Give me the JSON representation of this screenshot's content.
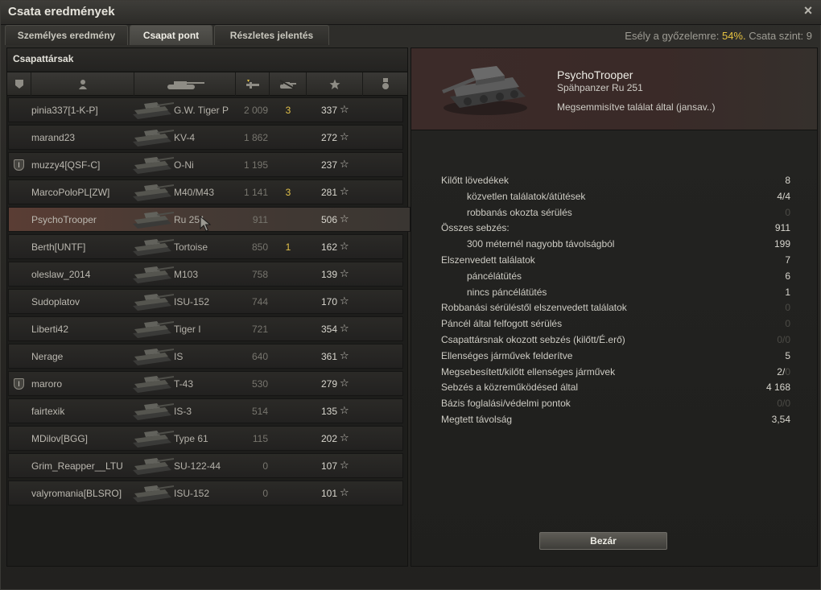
{
  "window": {
    "title": "Csata eredmények"
  },
  "tabs": [
    {
      "label": "Személyes eredmény"
    },
    {
      "label": "Csapat pont"
    },
    {
      "label": "Részletes jelentés"
    }
  ],
  "odds": {
    "prefix": "Esély a győzelemre:",
    "percent": "54%.",
    "tier_text": "Csata szint: 9"
  },
  "left_panel": {
    "title": "Csapattársak"
  },
  "columns": [
    "squad-icon",
    "player-icon",
    "tank-icon",
    "damage-icon",
    "kills-icon",
    "xp-star-icon",
    "medal-icon"
  ],
  "players": [
    {
      "name": "pinia337[1-K-P]",
      "tank": "G.W. Tiger P",
      "damage": "2 009",
      "kills": "3",
      "xp": "337",
      "platoon": ""
    },
    {
      "name": "marand23",
      "tank": "KV-4",
      "damage": "1 862",
      "kills": "",
      "xp": "272",
      "platoon": ""
    },
    {
      "name": "muzzy4[QSF-C]",
      "tank": "O-Ni",
      "damage": "1 195",
      "kills": "",
      "xp": "237",
      "platoon": "I"
    },
    {
      "name": "MarcoPoloPL[ZW]",
      "tank": "M40/M43",
      "damage": "1 141",
      "kills": "3",
      "xp": "281",
      "platoon": ""
    },
    {
      "name": "PsychoTrooper",
      "tank": "Ru 251",
      "damage": "911",
      "kills": "",
      "xp": "506",
      "platoon": ""
    },
    {
      "name": "Berth[UNTF]",
      "tank": "Tortoise",
      "damage": "850",
      "kills": "1",
      "xp": "162",
      "platoon": ""
    },
    {
      "name": "oleslaw_2014",
      "tank": "M103",
      "damage": "758",
      "kills": "",
      "xp": "139",
      "platoon": ""
    },
    {
      "name": "Sudoplatov",
      "tank": "ISU-152",
      "damage": "744",
      "kills": "",
      "xp": "170",
      "platoon": ""
    },
    {
      "name": "Liberti42",
      "tank": "Tiger I",
      "damage": "721",
      "kills": "",
      "xp": "354",
      "platoon": ""
    },
    {
      "name": "Nerage",
      "tank": "IS",
      "damage": "640",
      "kills": "",
      "xp": "361",
      "platoon": ""
    },
    {
      "name": "maroro",
      "tank": "T-43",
      "damage": "530",
      "kills": "",
      "xp": "279",
      "platoon": "I"
    },
    {
      "name": "fairtexik",
      "tank": "IS-3",
      "damage": "514",
      "kills": "",
      "xp": "135",
      "platoon": ""
    },
    {
      "name": "MDilov[BGG]",
      "tank": "Type 61",
      "damage": "115",
      "kills": "",
      "xp": "202",
      "platoon": ""
    },
    {
      "name": "Grim_Reapper__LTU",
      "tank": "SU-122-44",
      "damage": "0",
      "kills": "",
      "xp": "107",
      "platoon": ""
    },
    {
      "name": "valyromania[BLSRO]",
      "tank": "ISU-152",
      "damage": "0",
      "kills": "",
      "xp": "101",
      "platoon": ""
    }
  ],
  "selected": {
    "player": "PsychoTrooper",
    "vehicle": "Spähpanzer Ru 251",
    "status": "Megsemmisítve találat által (jansav..)"
  },
  "stats": [
    {
      "label": "Kilőtt lövedékek",
      "value": "8",
      "sub": false,
      "dim": false
    },
    {
      "label": "közvetlen találatok/átütések",
      "value": "4/4",
      "sub": true,
      "dim": false
    },
    {
      "label": "robbanás okozta sérülés",
      "value": "0",
      "sub": true,
      "dim": true
    },
    {
      "label": "Összes sebzés:",
      "value": "911",
      "sub": false,
      "dim": false
    },
    {
      "label": "300 méternél nagyobb távolságból",
      "value": "199",
      "sub": true,
      "dim": false
    },
    {
      "label": "Elszenvedett találatok",
      "value": "7",
      "sub": false,
      "dim": false
    },
    {
      "label": "páncélátütés",
      "value": "6",
      "sub": true,
      "dim": false
    },
    {
      "label": "nincs páncélátütés",
      "value": "1",
      "sub": true,
      "dim": false
    },
    {
      "label": "Robbanási sérüléstől elszenvedett találatok",
      "value": "0",
      "sub": false,
      "dim": true
    },
    {
      "label": "Páncél által felfogott sérülés",
      "value": "0",
      "sub": false,
      "dim": true
    },
    {
      "label": "Csapattársnak okozott sebzés (kilőtt/É.erő)",
      "value": "0/0",
      "sub": false,
      "dim": true
    },
    {
      "label": "Ellenséges járművek felderítve",
      "value": "5",
      "sub": false,
      "dim": false
    },
    {
      "label": "Megsebesített/kilőtt ellenséges járművek",
      "value": "2/",
      "value_dim": "0",
      "sub": false,
      "dim": false
    },
    {
      "label": "Sebzés a közreműködésed által",
      "value": "4 168",
      "sub": false,
      "dim": false
    },
    {
      "label": "Bázis foglalási/védelmi pontok",
      "value": "0/0",
      "sub": false,
      "dim": true
    },
    {
      "label": "Megtett távolság",
      "value": "3,54",
      "sub": false,
      "dim": false
    }
  ],
  "buttons": {
    "close_label": "Bezár",
    "close_icon": "×"
  },
  "colors": {
    "accent": "#e7c341",
    "highlight": "#5a3d34"
  }
}
